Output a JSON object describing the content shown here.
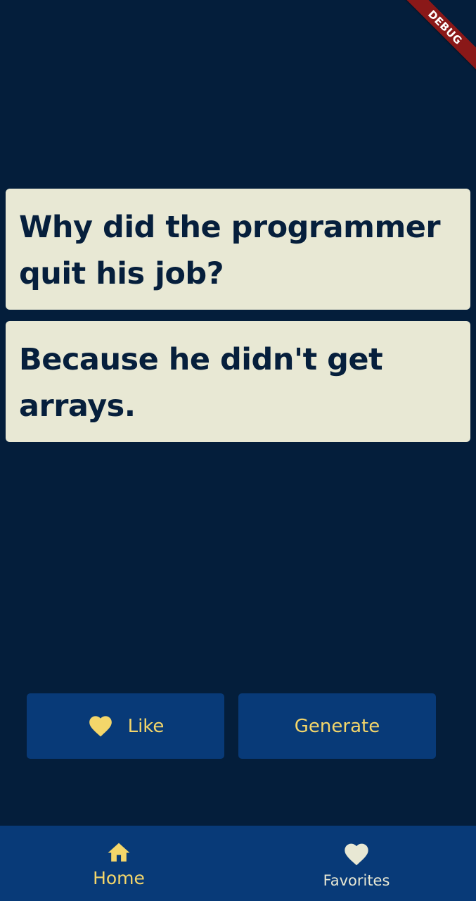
{
  "joke": {
    "setup": "Why did the programmer quit his job?",
    "punchline": "Because he didn't get arrays."
  },
  "actions": {
    "like_label": "Like",
    "like_icon": "heart-icon",
    "generate_label": "Generate"
  },
  "bottom_nav": {
    "items": [
      {
        "label": "Home",
        "icon": "home-icon",
        "selected": true
      },
      {
        "label": "Favorites",
        "icon": "heart-icon",
        "selected": false
      }
    ]
  },
  "debug_banner": "DEBUG",
  "colors": {
    "background": "#041e3b",
    "card": "#e8e8d4",
    "card_text": "#061f3c",
    "button": "#083a78",
    "accent": "#f4d66a",
    "inactive": "#e8e8d4",
    "debug_ribbon": "#8a1818"
  }
}
